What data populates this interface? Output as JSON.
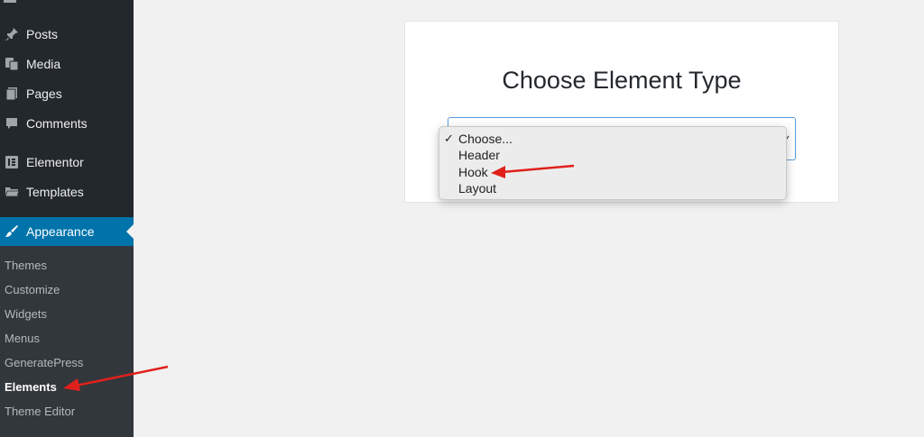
{
  "sidebar": {
    "items": [
      {
        "label": "Posts",
        "icon": "pin-icon"
      },
      {
        "label": "Media",
        "icon": "media-icon"
      },
      {
        "label": "Pages",
        "icon": "pages-icon"
      },
      {
        "label": "Comments",
        "icon": "comment-icon"
      },
      {
        "label": "Elementor",
        "icon": "elementor-icon"
      },
      {
        "label": "Templates",
        "icon": "folder-icon"
      },
      {
        "label": "Appearance",
        "icon": "paintbrush-icon",
        "active": true
      }
    ],
    "submenu": [
      {
        "label": "Themes"
      },
      {
        "label": "Customize"
      },
      {
        "label": "Widgets"
      },
      {
        "label": "Menus"
      },
      {
        "label": "GeneratePress"
      },
      {
        "label": "Elements",
        "active": true
      },
      {
        "label": "Theme Editor"
      }
    ]
  },
  "card": {
    "title": "Choose Element Type"
  },
  "select": {
    "selected": "Choose...",
    "options": [
      "Choose...",
      "Header",
      "Hook",
      "Layout"
    ]
  },
  "colors": {
    "sidebar_bg": "#23282d",
    "submenu_bg": "#32373c",
    "active_bg": "#0073aa",
    "annotation_arrow": "#e0201b"
  }
}
